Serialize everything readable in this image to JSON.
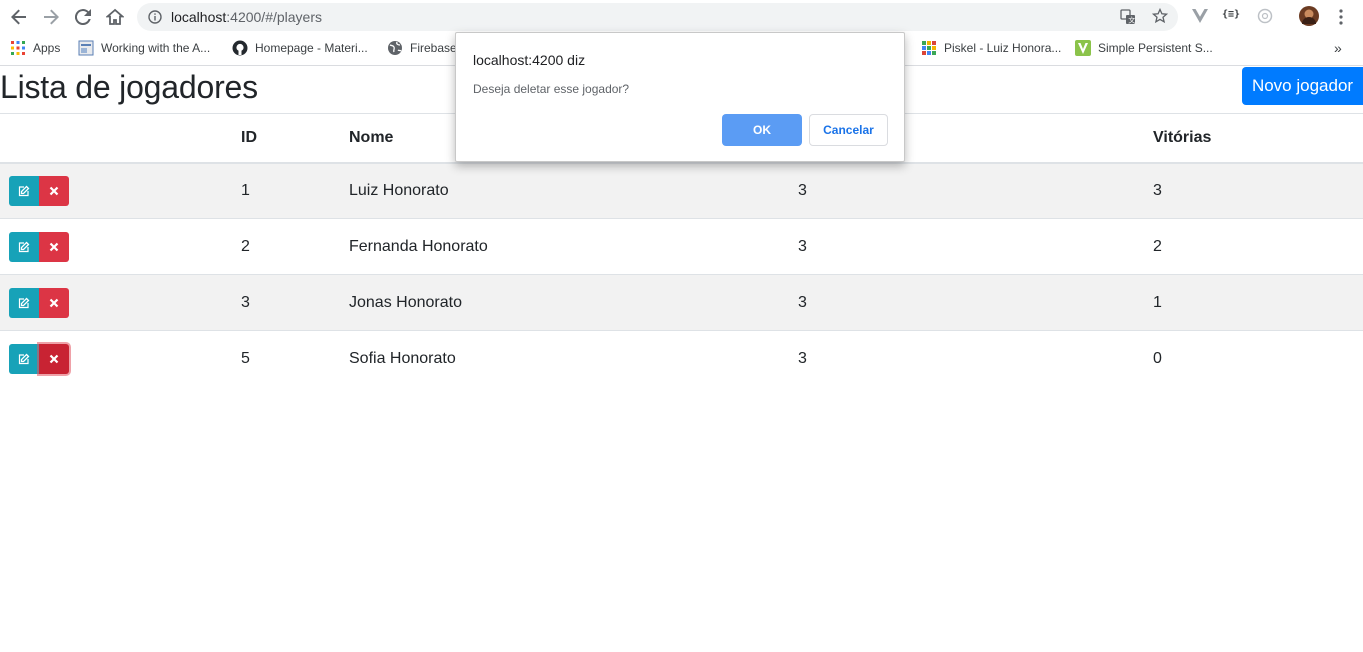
{
  "browser": {
    "url_host": "localhost",
    "url_path": ":4200/#/players",
    "bookmarks": [
      {
        "label": "Apps",
        "icon": "apps-grid-icon"
      },
      {
        "label": "Working with the A...",
        "icon": "page-favicon"
      },
      {
        "label": "Homepage - Materi...",
        "icon": "github-icon"
      },
      {
        "label": "Firebase",
        "icon": "globe-icon"
      },
      {
        "label": "Piskel - Luiz Honora...",
        "icon": "piskel-icon"
      },
      {
        "label": "Simple Persistent S...",
        "icon": "vue-icon"
      }
    ],
    "bookmarks_more": "»"
  },
  "page": {
    "title": "Lista de jogadores",
    "new_button": "Novo jogador"
  },
  "table": {
    "headers": [
      "",
      "ID",
      "Nome",
      "",
      "Vitórias"
    ],
    "rows": [
      {
        "id": "1",
        "name": "Luiz Honorato",
        "col3": "3",
        "wins": "3"
      },
      {
        "id": "2",
        "name": "Fernanda Honorato",
        "col3": "3",
        "wins": "2"
      },
      {
        "id": "3",
        "name": "Jonas Honorato",
        "col3": "3",
        "wins": "1"
      },
      {
        "id": "5",
        "name": "Sofia Honorato",
        "col3": "3",
        "wins": "0"
      }
    ]
  },
  "dialog": {
    "title": "localhost:4200 diz",
    "message": "Deseja deletar esse jogador?",
    "ok": "OK",
    "cancel": "Cancelar"
  },
  "colors": {
    "primary": "#007bff",
    "info": "#17a2b8",
    "danger": "#dc3545",
    "dialog_ok": "#5b9cf4"
  }
}
